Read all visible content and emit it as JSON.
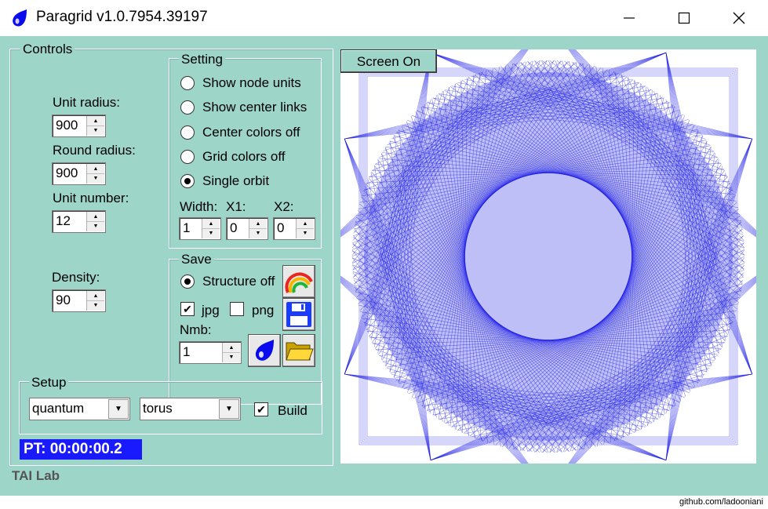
{
  "window": {
    "title": "Paragrid v1.0.7954.39197"
  },
  "controls": {
    "group_label": "Controls",
    "unit_radius_label": "Unit radius:",
    "unit_radius_value": "900",
    "round_radius_label": "Round radius:",
    "round_radius_value": "900",
    "unit_number_label": "Unit number:",
    "unit_number_value": "12",
    "density_label": "Density:",
    "density_value": "90"
  },
  "setting": {
    "group_label": "Setting",
    "options": [
      {
        "label": "Show node units",
        "checked": false
      },
      {
        "label": "Show center links",
        "checked": false
      },
      {
        "label": "Center colors off",
        "checked": false
      },
      {
        "label": "Grid colors off",
        "checked": false
      },
      {
        "label": "Single orbit",
        "checked": true
      }
    ],
    "width_label": "Width:",
    "width_value": "1",
    "x1_label": "X1:",
    "x1_value": "0",
    "x2_label": "X2:",
    "x2_value": "0"
  },
  "save": {
    "group_label": "Save",
    "structure_label": "Structure off",
    "structure_checked": true,
    "jpg_label": "jpg",
    "jpg_checked": true,
    "png_label": "png",
    "png_checked": false,
    "nmb_label": "Nmb:",
    "nmb_value": "1"
  },
  "setup": {
    "group_label": "Setup",
    "combo1_value": "quantum",
    "combo2_value": "torus",
    "build_label": "Build",
    "build_checked": true
  },
  "status": {
    "pt_text": "PT: 00:00:00.2",
    "footer": "TAI Lab"
  },
  "canvas": {
    "button_label": "Screen On",
    "line_color": "#1a1ae6"
  },
  "watermark": "github.com/ladooniani"
}
